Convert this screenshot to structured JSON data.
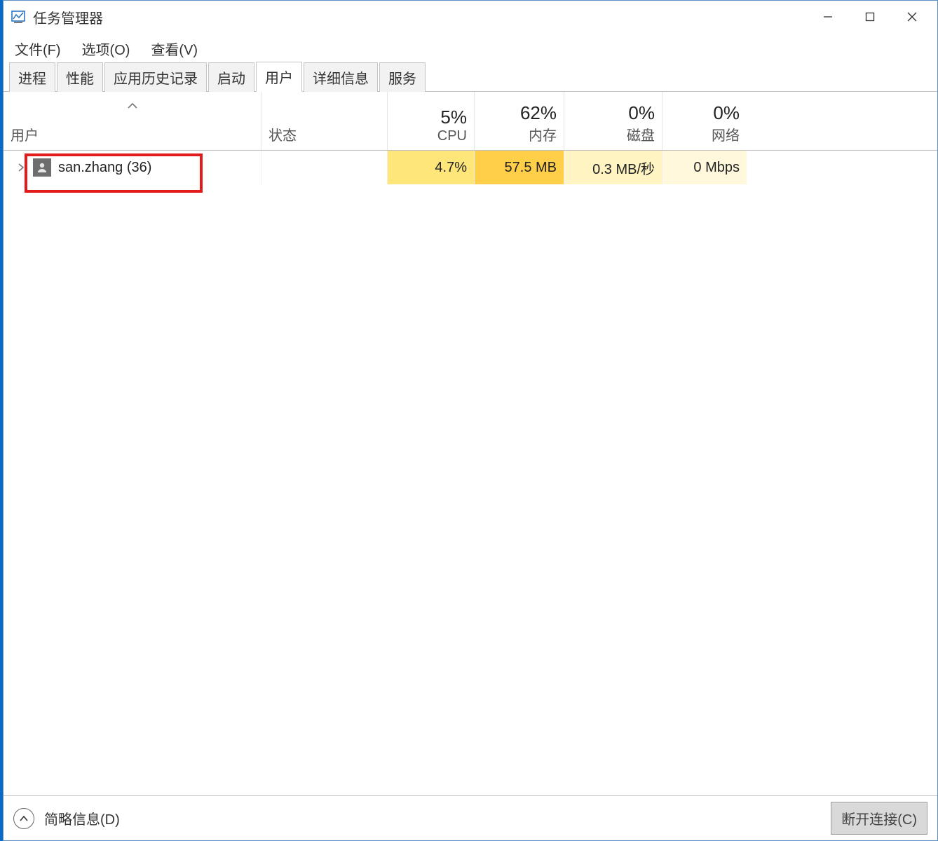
{
  "window": {
    "title": "任务管理器"
  },
  "menu": {
    "file": "文件(F)",
    "options": "选项(O)",
    "view": "查看(V)"
  },
  "tabs": [
    {
      "label": "进程",
      "active": false
    },
    {
      "label": "性能",
      "active": false
    },
    {
      "label": "应用历史记录",
      "active": false
    },
    {
      "label": "启动",
      "active": false
    },
    {
      "label": "用户",
      "active": true
    },
    {
      "label": "详细信息",
      "active": false
    },
    {
      "label": "服务",
      "active": false
    }
  ],
  "columns": {
    "user": {
      "label": "用户"
    },
    "status": {
      "label": "状态"
    },
    "cpu": {
      "pct": "5%",
      "label": "CPU"
    },
    "mem": {
      "pct": "62%",
      "label": "内存"
    },
    "disk": {
      "pct": "0%",
      "label": "磁盘"
    },
    "net": {
      "pct": "0%",
      "label": "网络"
    }
  },
  "rows": [
    {
      "name": "san.zhang (36)",
      "status": "",
      "cpu": "4.7%",
      "mem": "57.5 MB",
      "disk": "0.3 MB/秒",
      "net": "0 Mbps"
    }
  ],
  "footer": {
    "fewer_details": "简略信息(D)",
    "disconnect": "断开连接(C)"
  }
}
